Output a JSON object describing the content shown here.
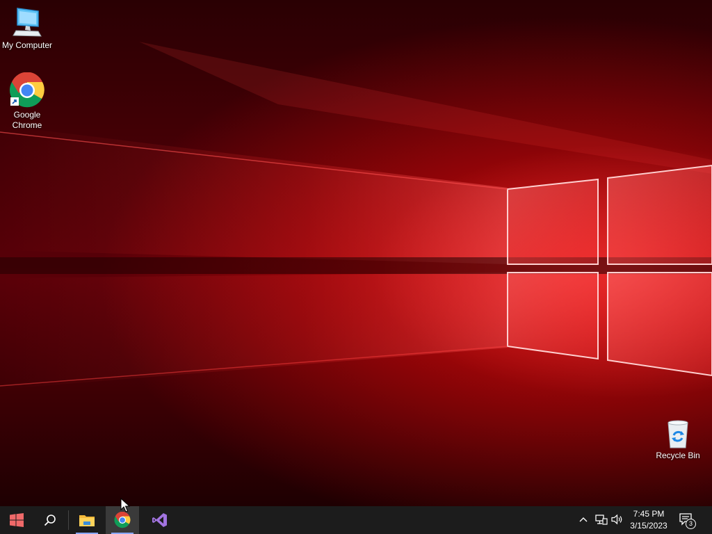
{
  "desktop": {
    "icons": [
      {
        "label": "My Computer",
        "icon": "computer-icon"
      },
      {
        "label": "Google Chrome",
        "icon": "chrome-icon"
      },
      {
        "label": "Recycle Bin",
        "icon": "recycle-bin-icon"
      }
    ]
  },
  "taskbar": {
    "start_icon": "windows-logo-icon",
    "search_icon": "search-icon",
    "apps": [
      {
        "name": "File Explorer",
        "icon": "folder-icon",
        "running": true,
        "active": false
      },
      {
        "name": "Google Chrome",
        "icon": "chrome-icon",
        "running": true,
        "active": true
      },
      {
        "name": "Visual Studio",
        "icon": "visual-studio-icon",
        "running": false,
        "active": false
      }
    ],
    "tray": {
      "icons": [
        "chevron-up-icon",
        "network-icon",
        "volume-icon"
      ],
      "time": "7:45 PM",
      "date": "3/15/2023",
      "notification_count": "3"
    }
  },
  "colors": {
    "taskbar_bg": "#1c1c1c",
    "wallpaper_accent": "#e60a0a"
  }
}
